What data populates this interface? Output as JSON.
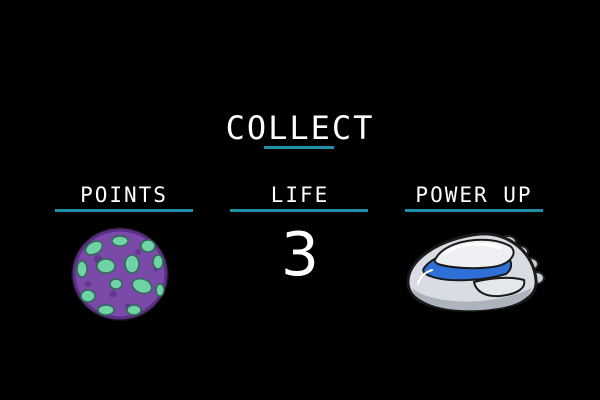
{
  "screen": {
    "title": "COLLECT"
  },
  "columns": [
    {
      "label": "POINTS",
      "icon": "spotted-purple-planet-icon"
    },
    {
      "label": "LIFE",
      "value": "3"
    },
    {
      "label": "POWER UP",
      "icon": "silver-spaceship-icon"
    }
  ],
  "colors": {
    "background": "#000000",
    "text": "#ffffff",
    "accent_underline": "#1f8fa6",
    "planet_purple": "#7b4aa8",
    "planet_spots": "#6fd3a6",
    "ship_silver": "#d9dde3",
    "ship_blue": "#2f6fd6"
  }
}
